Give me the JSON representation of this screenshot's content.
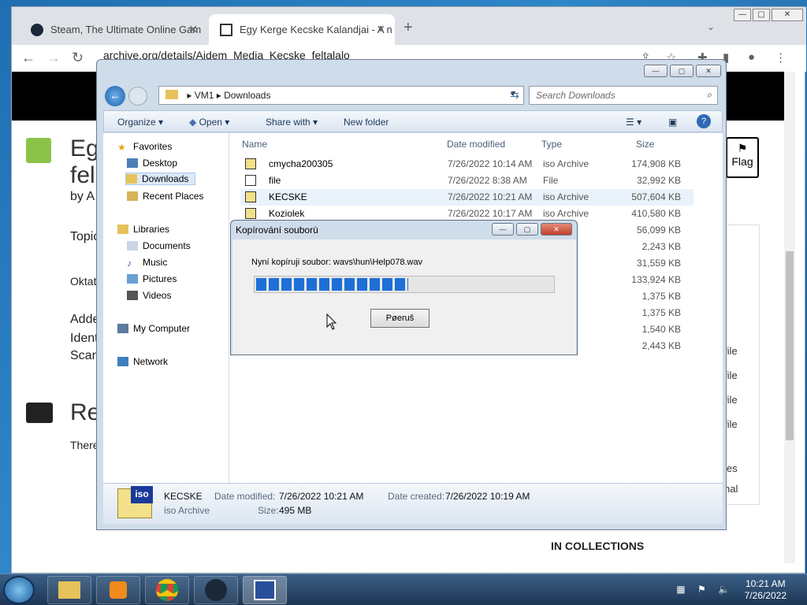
{
  "browser": {
    "tabs": [
      {
        "title": "Steam, The Ultimate Online Gam"
      },
      {
        "title": "Egy Kerge Kecske Kalandjai - A n"
      }
    ],
    "url": "archive.org/details/Aidem_Media_Kecske_feltalalo"
  },
  "page": {
    "title_line1": "Egy",
    "title_line2": "fel",
    "by": "by A",
    "topic": "Topic",
    "oktat": "Oktat",
    "added": "Adde",
    "ident": "Ident",
    "scan": "Scan",
    "reviews_heading": "Re",
    "there": "There",
    "flag_label": "Flag",
    "side_items": [
      "file",
      "file",
      "file",
      "file",
      "les",
      "nal"
    ],
    "in_collections": "IN COLLECTIONS"
  },
  "explorer": {
    "breadcrumb": [
      "VM1",
      "Downloads"
    ],
    "search_placeholder": "Search Downloads",
    "commands": {
      "organize": "Organize",
      "open": "Open",
      "share": "Share with",
      "new_folder": "New folder"
    },
    "nav": {
      "favorites": "Favorites",
      "desktop": "Desktop",
      "downloads": "Downloads",
      "recent": "Recent Places",
      "libraries": "Libraries",
      "documents": "Documents",
      "music": "Music",
      "pictures": "Pictures",
      "videos": "Videos",
      "computer": "My Computer",
      "network": "Network"
    },
    "columns": {
      "name": "Name",
      "date": "Date modified",
      "type": "Type",
      "size": "Size"
    },
    "files": [
      {
        "name": "cmycha200305",
        "date": "7/26/2022 10:14 AM",
        "type": "iso Archive",
        "size": "174,908 KB"
      },
      {
        "name": "file",
        "date": "7/26/2022 8:38 AM",
        "type": "File",
        "size": "32,992 KB"
      },
      {
        "name": "KECSKE",
        "date": "7/26/2022 10:21 AM",
        "type": "iso Archive",
        "size": "507,604 KB"
      },
      {
        "name": "Koziolek",
        "date": "7/26/2022 10:17 AM",
        "type": "iso Archive",
        "size": "410,580 KB"
      },
      {
        "name": "",
        "date": "",
        "type": "eo",
        "size": "56,099 KB"
      },
      {
        "name": "",
        "date": "",
        "type": "tion",
        "size": "2,243 KB"
      },
      {
        "name": "",
        "date": "",
        "type": "eo",
        "size": "31,559 KB"
      },
      {
        "name": "",
        "date": "",
        "type": "eo",
        "size": "133,924 KB"
      },
      {
        "name": "",
        "date": "",
        "type": "tion",
        "size": "1,375 KB"
      },
      {
        "name": "",
        "date": "",
        "type": "tion",
        "size": "1,375 KB"
      },
      {
        "name": "",
        "date": "",
        "type": "tion",
        "size": "1,540 KB"
      },
      {
        "name": "",
        "date": "",
        "type": "tion",
        "size": "2,443 KB"
      }
    ],
    "details": {
      "name": "KECSKE",
      "type": "iso Archive",
      "modified_label": "Date modified:",
      "modified_value": "7/26/2022 10:21 AM",
      "created_label": "Date created:",
      "created_value": "7/26/2022 10:19 AM",
      "size_label": "Size:",
      "size_value": "495 MB",
      "icon_text": "iso"
    }
  },
  "dialog": {
    "title": "Kopírování souborù",
    "status": "Nyní kopíruji soubor: wavs\\hun\\Help078.wav",
    "progress": 0.51,
    "abort_label": "Pøeruš"
  },
  "taskbar": {
    "time": "10:21 AM",
    "date": "7/26/2022"
  }
}
